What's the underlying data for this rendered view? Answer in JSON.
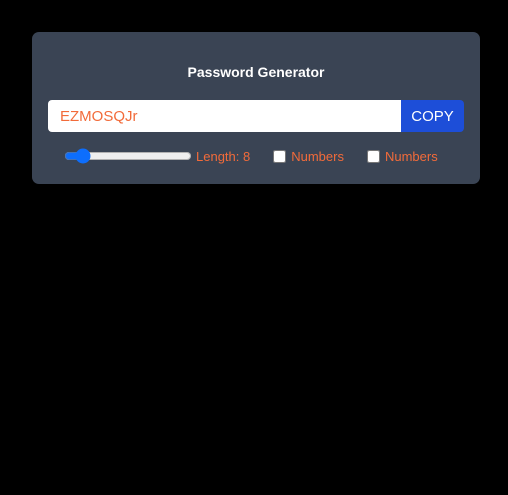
{
  "card": {
    "title": "Password Generator",
    "password_value": "EZMOSQJr",
    "copy_label": "COPY",
    "length_value": 8,
    "length_label": "Length: 8",
    "options": [
      {
        "label": "Numbers",
        "checked": false
      },
      {
        "label": "Numbers",
        "checked": false
      }
    ]
  },
  "colors": {
    "accent_text": "#f26b3a",
    "button": "#1d4ed8",
    "card": "#3a4454"
  }
}
